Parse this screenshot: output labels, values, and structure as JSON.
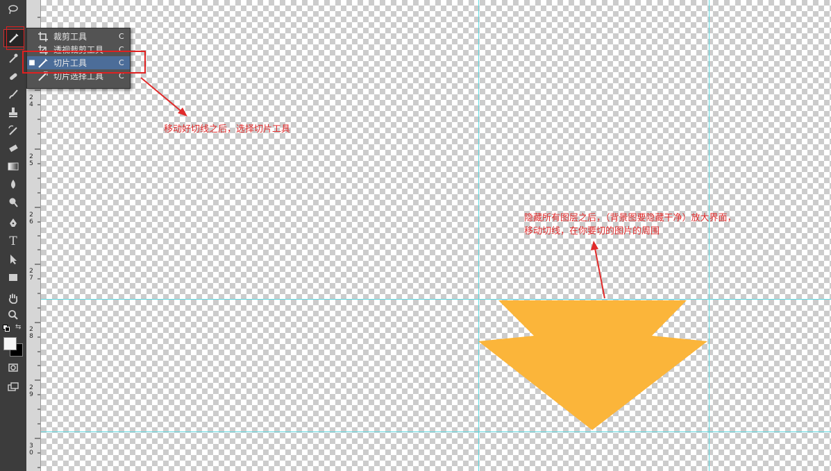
{
  "toolbar": {
    "tools": [
      {
        "name": "lasso-tool-icon"
      },
      {
        "name": "slice-tool-icon"
      },
      {
        "name": "eyedropper-tool-icon"
      },
      {
        "name": "healing-brush-tool-icon"
      },
      {
        "name": "brush-tool-icon"
      },
      {
        "name": "clone-stamp-tool-icon"
      },
      {
        "name": "history-brush-tool-icon"
      },
      {
        "name": "eraser-tool-icon"
      },
      {
        "name": "gradient-tool-icon"
      },
      {
        "name": "blur-tool-icon"
      },
      {
        "name": "dodge-tool-icon"
      },
      {
        "name": "pen-tool-icon"
      },
      {
        "name": "type-tool-icon",
        "glyph": "T"
      },
      {
        "name": "path-selection-tool-icon"
      },
      {
        "name": "rectangle-tool-icon"
      },
      {
        "name": "hand-tool-icon"
      },
      {
        "name": "zoom-tool-icon"
      }
    ]
  },
  "ruler": {
    "labels": [
      "24",
      "25",
      "26",
      "27",
      "28",
      "29",
      "30"
    ]
  },
  "flyout": {
    "items": [
      {
        "label": "裁剪工具",
        "shortcut": "C",
        "selected": false,
        "icon": "crop-icon"
      },
      {
        "label": "透视裁剪工具",
        "shortcut": "C",
        "selected": false,
        "icon": "perspective-crop-icon"
      },
      {
        "label": "切片工具",
        "shortcut": "C",
        "selected": true,
        "icon": "slice-icon"
      },
      {
        "label": "切片选择工具",
        "shortcut": "C",
        "selected": false,
        "icon": "slice-select-icon"
      }
    ],
    "bullet": "■"
  },
  "annotations": {
    "note1": "移动好切线之后，选择切片工具",
    "note2_line1": "隐藏所有图层之后，（背景图要隐藏干净）放大界面，",
    "note2_line2": "移动切线，在你要切的图片的周围"
  },
  "colors": {
    "annotation": "#e02a2a",
    "guide": "#5fd8e0",
    "shape": "#fbb53a",
    "highlight": "#4c6d99"
  }
}
